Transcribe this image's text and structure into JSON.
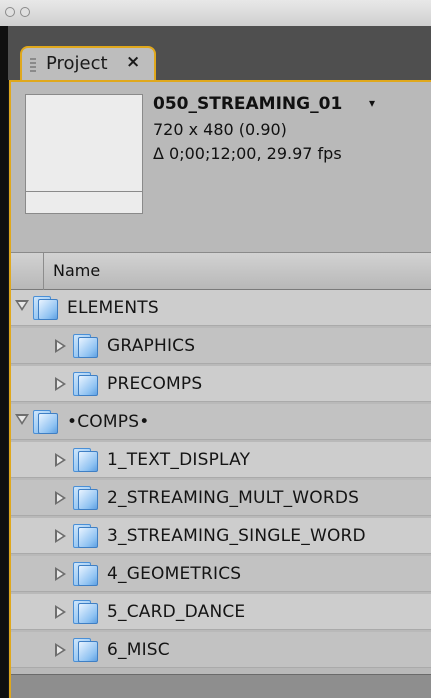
{
  "window": {
    "controls": [
      "close",
      "minimize"
    ]
  },
  "panel_tab": {
    "label": "Project",
    "close_glyph": "×",
    "grip_icon": "panel-grip-icon"
  },
  "composition": {
    "name": "050_STREAMING_01",
    "dropdown_glyph": "▾",
    "size": "720 x 480 (0.90)",
    "duration": "Δ 0;00;12;00, 29.97 fps"
  },
  "list_header": {
    "name": "Name"
  },
  "tree": [
    {
      "label": "ELEMENTS",
      "level": 0,
      "expanded": true
    },
    {
      "label": "GRAPHICS",
      "level": 1,
      "expanded": false
    },
    {
      "label": "PRECOMPS",
      "level": 1,
      "expanded": false
    },
    {
      "label": "•COMPS•",
      "level": 0,
      "expanded": true
    },
    {
      "label": "1_TEXT_DISPLAY",
      "level": 1,
      "expanded": false
    },
    {
      "label": "2_STREAMING_MULT_WORDS",
      "level": 1,
      "expanded": false
    },
    {
      "label": "3_STREAMING_SINGLE_WORD",
      "level": 1,
      "expanded": false
    },
    {
      "label": "4_GEOMETRICS",
      "level": 1,
      "expanded": false
    },
    {
      "label": "5_CARD_DANCE",
      "level": 1,
      "expanded": false
    },
    {
      "label": "6_MISC",
      "level": 1,
      "expanded": false
    }
  ],
  "colors": {
    "accent": "#e0a81c",
    "panel_bg": "#b9b9b9",
    "folder_blue": "#6fb0ec"
  }
}
